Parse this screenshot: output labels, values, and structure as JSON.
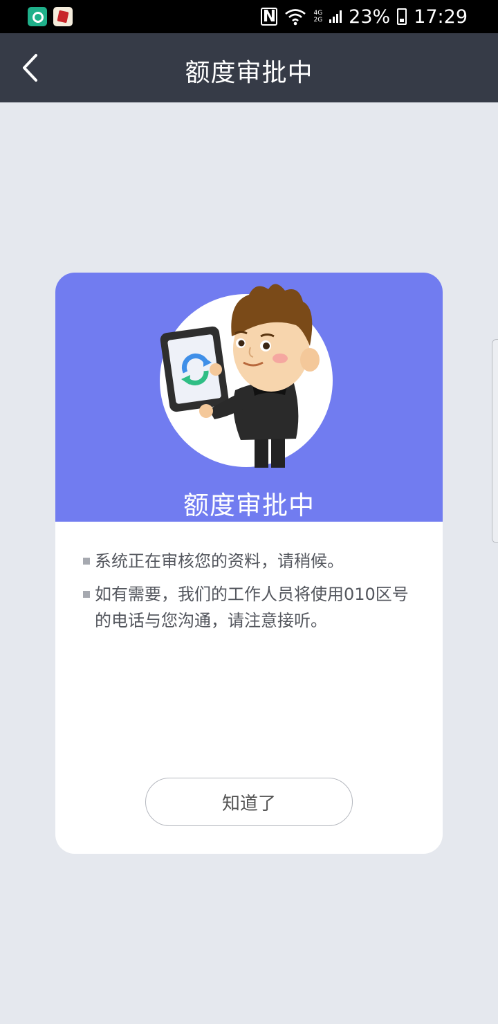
{
  "statusbar": {
    "app_icons": [
      "message-app-icon",
      "toutiao-app-icon"
    ],
    "nfc_label": "N",
    "network_top": "4G",
    "network_bottom": "2G",
    "battery": "23%",
    "time": "17:29"
  },
  "navbar": {
    "title": "额度审批中",
    "back_icon": "chevron-left-icon"
  },
  "card": {
    "header_color": "#717cf0",
    "title": "额度审批中",
    "illustration": "man-with-tablet-illustration",
    "bullets": [
      "系统正在审核您的资料，请稍候。",
      "如有需要，我们的工作人员将使用010区号的电话与您沟通，请注意接听。"
    ],
    "button_label": "知道了"
  },
  "colors": {
    "navbar_bg": "#363b47",
    "page_bg": "#e5e8ee",
    "accent": "#717cf0"
  }
}
